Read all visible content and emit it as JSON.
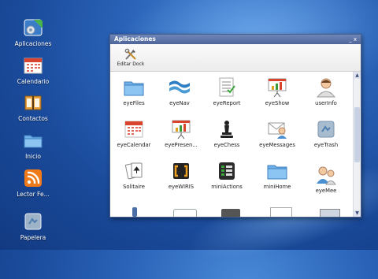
{
  "desktop": {
    "icons": [
      {
        "label": "Aplicaciones",
        "icon": "applications-icon"
      },
      {
        "label": "Calendario",
        "icon": "calendar-icon"
      },
      {
        "label": "Contactos",
        "icon": "contacts-icon"
      },
      {
        "label": "Inicio",
        "icon": "folder-home-icon"
      },
      {
        "label": "Lector Fe...",
        "icon": "rss-feed-icon"
      },
      {
        "label": "Papelera",
        "icon": "trash-icon"
      }
    ]
  },
  "window": {
    "title": "Aplicaciones",
    "controls": "_ x",
    "toolbar": {
      "edit_dock_label": "Editar Dock"
    },
    "apps": [
      {
        "label": "eyeFiles",
        "icon": "folder-icon"
      },
      {
        "label": "eyeNav",
        "icon": "browser-icon"
      },
      {
        "label": "eyeReport",
        "icon": "report-icon"
      },
      {
        "label": "eyeShow",
        "icon": "presentation-icon"
      },
      {
        "label": "userInfo",
        "icon": "user-icon"
      },
      {
        "label": "eyeCalendar",
        "icon": "calendar-icon"
      },
      {
        "label": "eyePresen...",
        "icon": "presentation-icon"
      },
      {
        "label": "eyeChess",
        "icon": "chess-icon"
      },
      {
        "label": "eyeMessages",
        "icon": "messages-icon"
      },
      {
        "label": "eyeTrash",
        "icon": "trash-icon"
      },
      {
        "label": "Solitaire",
        "icon": "cards-icon"
      },
      {
        "label": "eyeWIRIS",
        "icon": "wiris-icon"
      },
      {
        "label": "miniActions",
        "icon": "actions-icon"
      },
      {
        "label": "miniHome",
        "icon": "folder-home-icon"
      },
      {
        "label": "eyeMee",
        "icon": "users-icon"
      }
    ]
  }
}
